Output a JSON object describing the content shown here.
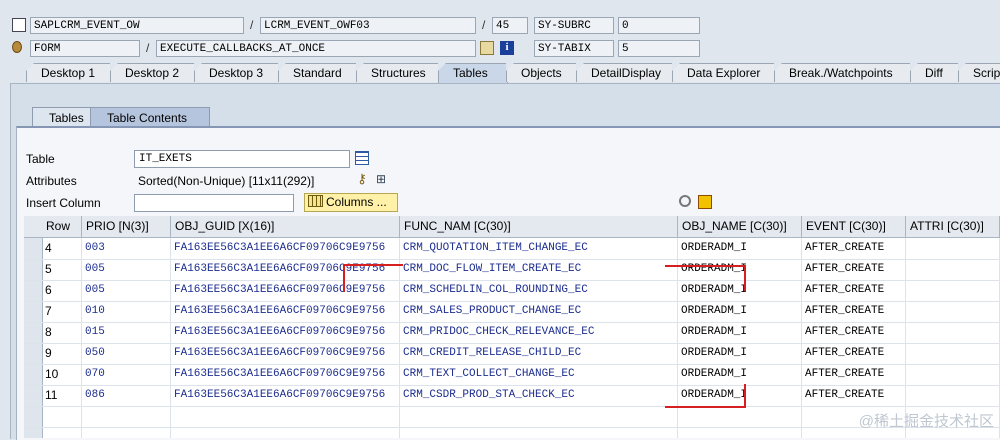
{
  "header": {
    "row1": {
      "program": "SAPLCRM_EVENT_OW",
      "include": "LCRM_EVENT_OWF03",
      "line": "45",
      "sy_label": "SY-SUBRC",
      "sy_value": "0"
    },
    "row2": {
      "type": "FORM",
      "name": "EXECUTE_CALLBACKS_AT_ONCE",
      "sy_label": "SY-TABIX",
      "sy_value": "5"
    }
  },
  "tabs": [
    "Desktop 1",
    "Desktop 2",
    "Desktop 3",
    "Standard",
    "Structures",
    "Tables",
    "Objects",
    "DetailDisplay",
    "Data Explorer",
    "Break./Watchpoints",
    "Diff",
    "Script"
  ],
  "subtabs": [
    "Tables",
    "Table Contents"
  ],
  "form": {
    "table_label": "Table",
    "table_value": "IT_EXETS",
    "attributes_label": "Attributes",
    "attributes_value": "Sorted(Non-Unique) [11x11(292)]",
    "insert_column_label": "Insert Column",
    "columns_button": "Columns ..."
  },
  "grid": {
    "headers": [
      "Row",
      "PRIO [N(3)]",
      "OBJ_GUID [X(16)]",
      "FUNC_NAM [C(30)]",
      "OBJ_NAME [C(30)]",
      "EVENT [C(30)]",
      "ATTRI [C(30)]"
    ],
    "rows": [
      [
        "4",
        "003",
        "FA163EE56C3A1EE6A6CF09706C9E9756",
        "CRM_QUOTATION_ITEM_CHANGE_EC",
        "ORDERADM_I",
        "AFTER_CREATE",
        ""
      ],
      [
        "5",
        "005",
        "FA163EE56C3A1EE6A6CF09706C9E9756",
        "CRM_DOC_FLOW_ITEM_CREATE_EC",
        "ORDERADM_I",
        "AFTER_CREATE",
        ""
      ],
      [
        "6",
        "005",
        "FA163EE56C3A1EE6A6CF09706C9E9756",
        "CRM_SCHEDLIN_COL_ROUNDING_EC",
        "ORDERADM_I",
        "AFTER_CREATE",
        ""
      ],
      [
        "7",
        "010",
        "FA163EE56C3A1EE6A6CF09706C9E9756",
        "CRM_SALES_PRODUCT_CHANGE_EC",
        "ORDERADM_I",
        "AFTER_CREATE",
        ""
      ],
      [
        "8",
        "015",
        "FA163EE56C3A1EE6A6CF09706C9E9756",
        "CRM_PRIDOC_CHECK_RELEVANCE_EC",
        "ORDERADM_I",
        "AFTER_CREATE",
        ""
      ],
      [
        "9",
        "050",
        "FA163EE56C3A1EE6A6CF09706C9E9756",
        "CRM_CREDIT_RELEASE_CHILD_EC",
        "ORDERADM_I",
        "AFTER_CREATE",
        ""
      ],
      [
        "10",
        "070",
        "FA163EE56C3A1EE6A6CF09706C9E9756",
        "CRM_TEXT_COLLECT_CHANGE_EC",
        "ORDERADM_I",
        "AFTER_CREATE",
        ""
      ],
      [
        "11",
        "086",
        "FA163EE56C3A1EE6A6CF09706C9E9756",
        "CRM_CSDR_PROD_STA_CHECK_EC",
        "ORDERADM_I",
        "AFTER_CREATE",
        ""
      ]
    ]
  },
  "watermark": "@稀土掘金技术社区",
  "colors": {
    "accent_red": "#d62020",
    "value_blue": "#1c2d8f"
  }
}
